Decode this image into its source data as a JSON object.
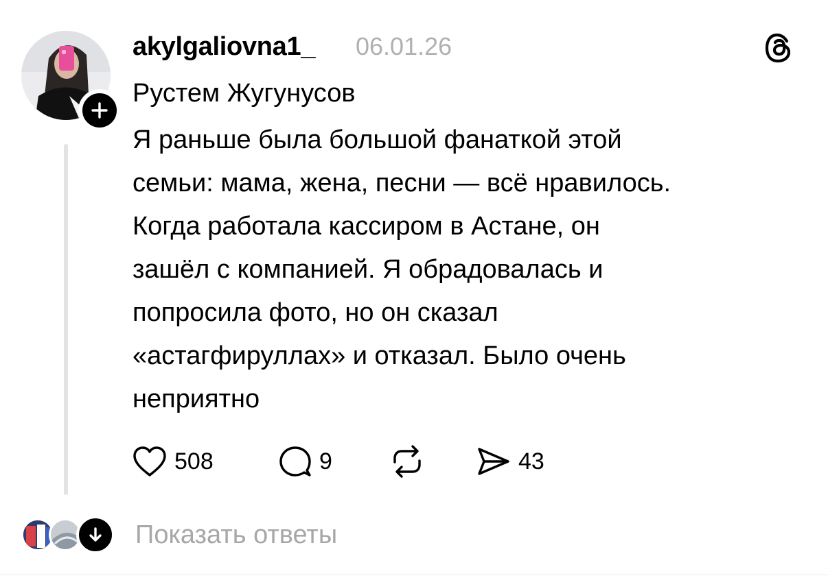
{
  "post": {
    "author": {
      "username": "akylgaliovna1_",
      "avatar_icon": "profile-photo"
    },
    "timestamp": "06.01.26",
    "mention": "Рустем Жугунусов",
    "body_lines": [
      "Я раньше была большой фанаткой этой",
      "семьи: мама, жена, песни — всё нравилось.",
      "Когда работала кассиром в Астане, он",
      "зашёл с компанией. Я обрадовалась и",
      "попросила фото, но он сказал",
      "«астагфируллах» и отказал. Было очень",
      "неприятно"
    ],
    "actions": {
      "likes": "508",
      "replies": "9",
      "reposts": "",
      "shares": "43"
    }
  },
  "replies_footer": {
    "label": "Показать ответы"
  },
  "icons": {
    "follow": "plus-icon",
    "brand": "threads-logo-icon",
    "like": "heart-icon",
    "reply": "comment-bubble-icon",
    "repost": "repost-icon",
    "share": "send-icon",
    "expand": "arrow-down-icon"
  },
  "colors": {
    "text": "#000000",
    "muted": "#b0b0b3",
    "thread_line": "#e3e3e4",
    "accent_pink": "#e84f9a"
  }
}
